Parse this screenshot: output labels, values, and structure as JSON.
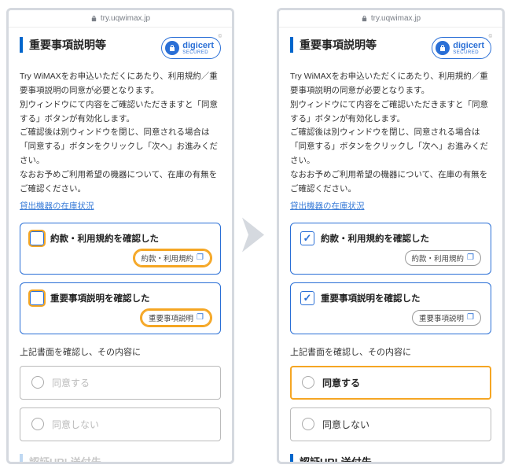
{
  "url": "try.uqwimax.jp",
  "title": "重要事項説明等",
  "seal": {
    "brand": "digicert",
    "sub": "SECURED",
    "copy": "©"
  },
  "body": "Try WiMAXをお申込いただくにあたり、利用規約／重要事項説明の同意が必要となります。\n別ウィンドウにて内容をご確認いただきますと「同意する」ボタンが有効化します。\nご確認後は別ウィンドウを閉じ、同意される場合は「同意する」ボタンをクリックし「次へ」お進みください。\nなおお予めご利用希望の機器について、在庫の有無をご確認ください。",
  "stock_link": "貸出機器の在庫状況",
  "check1": {
    "label": "約款・利用規約を確認した",
    "pill": "約款・利用規約"
  },
  "check2": {
    "label": "重要事項説明を確認した",
    "pill": "重要事項説明"
  },
  "confirm_text": "上記書面を確認し、その内容に",
  "agree": "同意する",
  "disagree": "同意しない",
  "next_section": "認証URL送付先",
  "next_section_cut": "認証URL送付先"
}
